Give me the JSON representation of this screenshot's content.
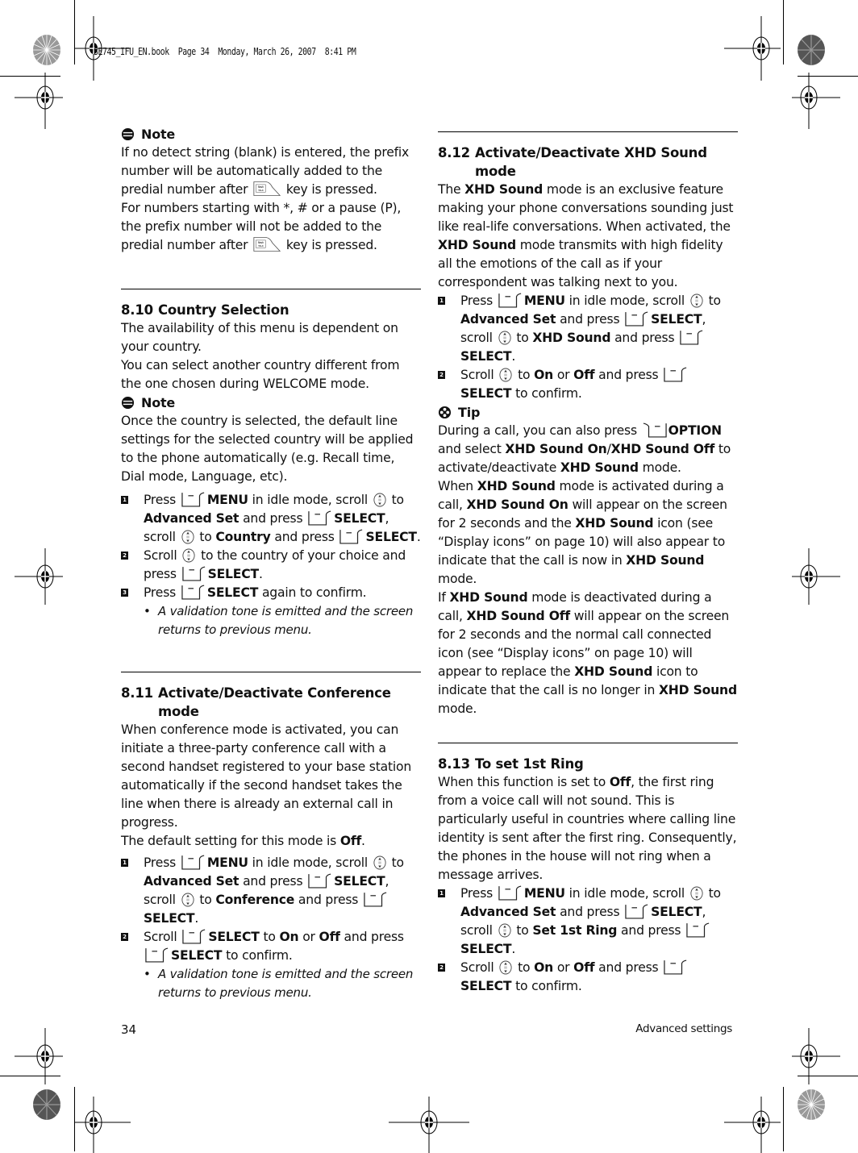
{
  "print_stamp": "SE745_IFU_EN.book  Page 34  Monday, March 26, 2007  8:41 PM",
  "footer": {
    "page_number": "34",
    "section": "Advanced settings"
  },
  "keys": {
    "menu": "MENU",
    "select": "SELECT",
    "option": "OPTION",
    "icons": [
      "flash-talk-key-icon",
      "softkey-right-icon",
      "softkey-left-icon",
      "scroll-key-icon",
      "note-icon",
      "tip-icon"
    ]
  },
  "left": {
    "note1": {
      "heading": "Note",
      "p1_a": "If no detect string (blank) is entered, the prefix number will be automatically added to the predial number after",
      "p1_b": "key is pressed.",
      "p2_a": "For numbers starting with *, # or a pause (P), the prefix number will not be added to the predial number after",
      "p2_b": "key is pressed."
    },
    "s810": {
      "num": "8.10",
      "title": "Country Selection",
      "p1": "The availability of this menu is dependent on your country.",
      "p2": "You can select another country different from the one chosen during WELCOME mode.",
      "note_heading": "Note",
      "note_text": "Once the country is selected, the default line settings for the selected country will be applied to the phone automatically (e.g. Recall time, Dial mode, Language, etc).",
      "steps": [
        {
          "n": "1",
          "t1": "Press",
          "t2": "in idle mode, scroll",
          "t3": "to",
          "b1": "Advanced Set",
          "t4": "and press",
          "t5": ", scroll",
          "t6": "to",
          "b2": "Country",
          "t7": "and press",
          "t8": "."
        },
        {
          "n": "2",
          "t1": "Scroll",
          "t2": "to the country of your choice and press",
          "t3": "."
        },
        {
          "n": "3",
          "t1": "Press",
          "t2": "again to confirm."
        }
      ],
      "bullet": "A validation tone is emitted and the screen returns to previous menu."
    },
    "s811": {
      "num": "8.11",
      "title": "Activate/Deactivate Conference mode",
      "p1": "When conference mode is activated, you can initiate a three-party conference call with a second handset registered to your base station automatically if the second handset takes the line when there is already an external call in progress.",
      "p2_a": "The default setting for this mode is",
      "p2_b": "Off",
      "p2_c": ".",
      "steps": [
        {
          "n": "1",
          "t1": "Press",
          "t2": "in idle mode, scroll",
          "t3": "to",
          "b1": "Advanced Set",
          "t4": "and press",
          "t5": ", scroll",
          "t6": "to",
          "b2": "Conference",
          "t7": "and press",
          "t8": "."
        },
        {
          "n": "2",
          "t1": "Scroll",
          "t2": "to",
          "b1": "On",
          "t3": "or",
          "b2": "Off",
          "t4": "and press",
          "t5": "to confirm."
        }
      ],
      "bullet": "A validation tone is emitted and the screen returns to previous menu."
    }
  },
  "right": {
    "s812": {
      "num": "8.12",
      "title": "Activate/Deactivate XHD Sound mode",
      "p1_a": "The",
      "xhd": "XHD Sound",
      "p1_b": "mode is an exclusive feature making your phone conversations sounding just like real-life conversations. When activated, the",
      "p1_c": "mode transmits with high fidelity all the emotions of the call as if your correspondent was talking next to you.",
      "steps": [
        {
          "n": "1",
          "t1": "Press",
          "t2": "in idle mode, scroll",
          "t3": "to",
          "b1": "Advanced Set",
          "t4": "and press",
          "t5": ", scroll",
          "t6": "to",
          "b2": "XHD Sound",
          "t7": "and press",
          "t8": "."
        },
        {
          "n": "2",
          "t1": "Scroll",
          "t2": "to",
          "b1": "On",
          "t3": "or",
          "b2": "Off",
          "t4": "and press",
          "t5": "to confirm."
        }
      ],
      "tip_heading": "Tip",
      "tip": {
        "a": "During a call, you can also press",
        "b": "and select",
        "on": "XHD Sound On",
        "slash": "/",
        "off": "XHD Sound Off",
        "c": "to activate/deactivate",
        "d": "mode.",
        "e": "When",
        "f": "mode is activated during a call,",
        "g": "will appear on the screen for 2 seconds and the",
        "h": "icon (see “Display icons” on page 10) will also appear to indicate that the call is now in",
        "i": "mode.",
        "j": "If",
        "k": "mode is deactivated during a call,",
        "l": "will appear on the screen for 2 seconds and the normal call connected icon (see “Display icons” on page 10) will appear to replace the",
        "m": "icon to indicate that the call is no longer in",
        "n": "mode."
      }
    },
    "s813": {
      "num": "8.13",
      "title": "To set 1st Ring",
      "p1_a": "When this function is set to",
      "p1_b": "Off",
      "p1_c": ", the first ring from a voice call will not sound. This is particularly useful in countries where calling line identity is sent after the first ring. Consequently, the phones in the house will not ring when a message arrives.",
      "steps": [
        {
          "n": "1",
          "t1": "Press",
          "t2": "in idle mode, scroll",
          "t3": "to",
          "b1": "Advanced Set",
          "t4": "and press",
          "t5": ",  scroll",
          "t6": "to",
          "b2": "Set 1st Ring",
          "t7": "and press",
          "t8": "."
        },
        {
          "n": "2",
          "t1": "Scroll",
          "t2": "to",
          "b1": "On",
          "t3": "or",
          "b2": "Off",
          "t4": "and press",
          "t5": "to confirm."
        }
      ]
    }
  }
}
